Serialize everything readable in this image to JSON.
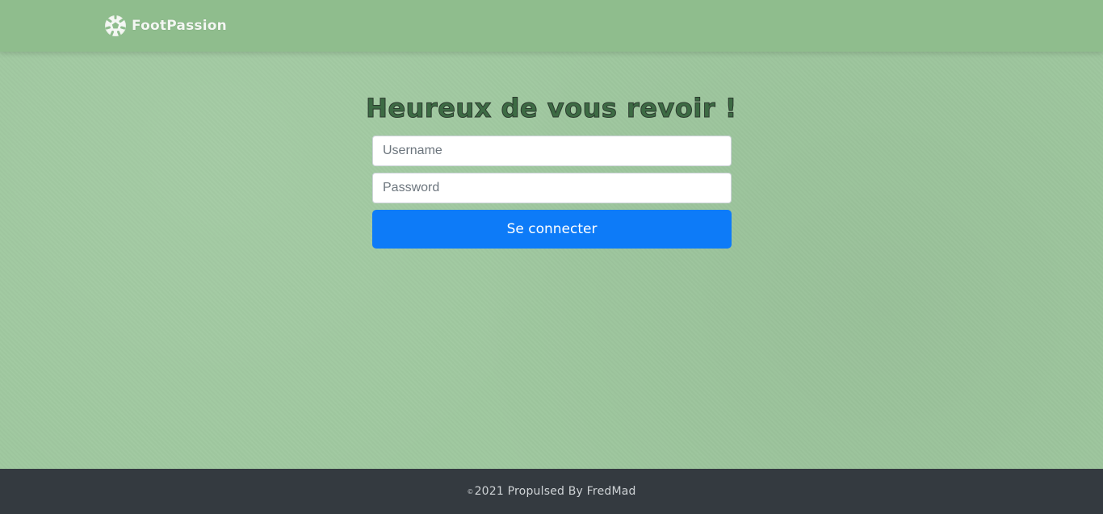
{
  "navbar": {
    "brand_name": "FootPassion",
    "brand_icon": "soccer-ball-icon"
  },
  "login": {
    "heading": "Heureux de vous revoir !",
    "username_placeholder": "Username",
    "username_value": "",
    "password_placeholder": "Password",
    "password_value": "",
    "submit_label": "Se connecter"
  },
  "footer": {
    "copyright_symbol": "©",
    "text": "2021 Propulsed By FredMad"
  },
  "colors": {
    "navbar_bg": "#8fbd8d",
    "page_bg": "#9fc89f",
    "button_bg": "#0d7bf8",
    "footer_bg": "#343a40"
  }
}
